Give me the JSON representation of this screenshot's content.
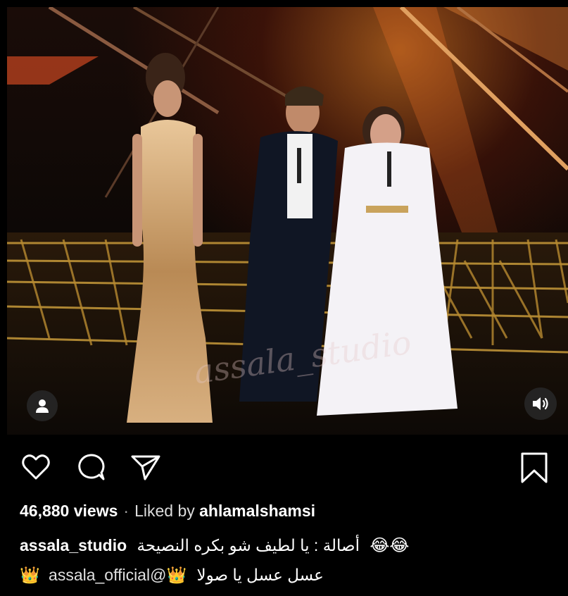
{
  "post": {
    "views": "46,880 views",
    "separator": "·",
    "liked_by_label": "Liked by",
    "liked_by_user": "ahlamalshamsi",
    "caption_user": "assala_studio",
    "caption_text": "أصالة : يا لطيف شو بكره النصيحة",
    "caption_emoji": "😂😂",
    "line2_emoji_left": "👑",
    "line2_mention": "assala_official@",
    "line2_emoji_right": "👑",
    "line2_text": "عسل عسل يا صولا"
  },
  "video": {
    "watermark": "assala_studio"
  },
  "icons": {
    "like": "heart-icon",
    "comment": "comment-icon",
    "share": "paper-plane-icon",
    "save": "bookmark-icon",
    "tagged": "person-icon",
    "sound": "speaker-icon"
  },
  "colors": {
    "background": "#000000",
    "text": "#ffffff",
    "muted": "#aaaaaa"
  }
}
